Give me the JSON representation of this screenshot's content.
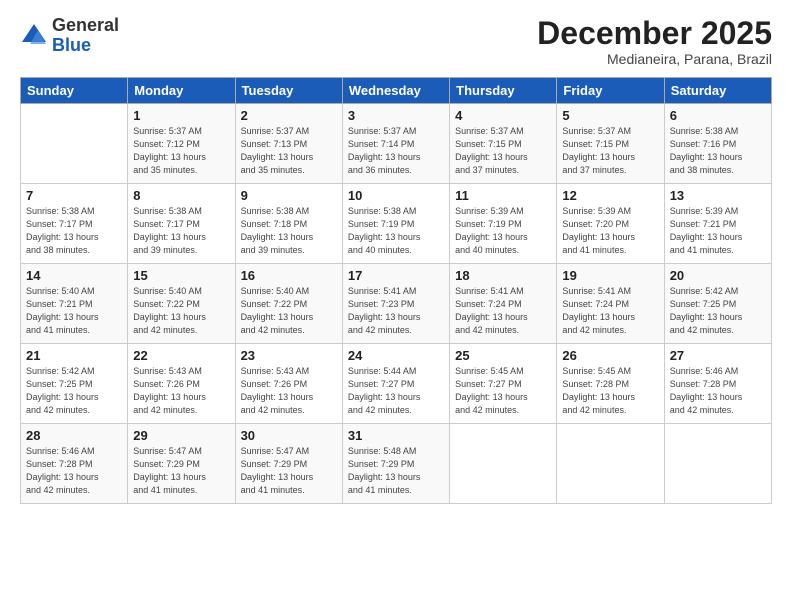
{
  "logo": {
    "general": "General",
    "blue": "Blue"
  },
  "title": "December 2025",
  "location": "Medianeira, Parana, Brazil",
  "days_of_week": [
    "Sunday",
    "Monday",
    "Tuesday",
    "Wednesday",
    "Thursday",
    "Friday",
    "Saturday"
  ],
  "weeks": [
    [
      {
        "day": "",
        "info": ""
      },
      {
        "day": "1",
        "info": "Sunrise: 5:37 AM\nSunset: 7:12 PM\nDaylight: 13 hours\nand 35 minutes."
      },
      {
        "day": "2",
        "info": "Sunrise: 5:37 AM\nSunset: 7:13 PM\nDaylight: 13 hours\nand 35 minutes."
      },
      {
        "day": "3",
        "info": "Sunrise: 5:37 AM\nSunset: 7:14 PM\nDaylight: 13 hours\nand 36 minutes."
      },
      {
        "day": "4",
        "info": "Sunrise: 5:37 AM\nSunset: 7:15 PM\nDaylight: 13 hours\nand 37 minutes."
      },
      {
        "day": "5",
        "info": "Sunrise: 5:37 AM\nSunset: 7:15 PM\nDaylight: 13 hours\nand 37 minutes."
      },
      {
        "day": "6",
        "info": "Sunrise: 5:38 AM\nSunset: 7:16 PM\nDaylight: 13 hours\nand 38 minutes."
      }
    ],
    [
      {
        "day": "7",
        "info": "Sunrise: 5:38 AM\nSunset: 7:17 PM\nDaylight: 13 hours\nand 38 minutes."
      },
      {
        "day": "8",
        "info": "Sunrise: 5:38 AM\nSunset: 7:17 PM\nDaylight: 13 hours\nand 39 minutes."
      },
      {
        "day": "9",
        "info": "Sunrise: 5:38 AM\nSunset: 7:18 PM\nDaylight: 13 hours\nand 39 minutes."
      },
      {
        "day": "10",
        "info": "Sunrise: 5:38 AM\nSunset: 7:19 PM\nDaylight: 13 hours\nand 40 minutes."
      },
      {
        "day": "11",
        "info": "Sunrise: 5:39 AM\nSunset: 7:19 PM\nDaylight: 13 hours\nand 40 minutes."
      },
      {
        "day": "12",
        "info": "Sunrise: 5:39 AM\nSunset: 7:20 PM\nDaylight: 13 hours\nand 41 minutes."
      },
      {
        "day": "13",
        "info": "Sunrise: 5:39 AM\nSunset: 7:21 PM\nDaylight: 13 hours\nand 41 minutes."
      }
    ],
    [
      {
        "day": "14",
        "info": "Sunrise: 5:40 AM\nSunset: 7:21 PM\nDaylight: 13 hours\nand 41 minutes."
      },
      {
        "day": "15",
        "info": "Sunrise: 5:40 AM\nSunset: 7:22 PM\nDaylight: 13 hours\nand 42 minutes."
      },
      {
        "day": "16",
        "info": "Sunrise: 5:40 AM\nSunset: 7:22 PM\nDaylight: 13 hours\nand 42 minutes."
      },
      {
        "day": "17",
        "info": "Sunrise: 5:41 AM\nSunset: 7:23 PM\nDaylight: 13 hours\nand 42 minutes."
      },
      {
        "day": "18",
        "info": "Sunrise: 5:41 AM\nSunset: 7:24 PM\nDaylight: 13 hours\nand 42 minutes."
      },
      {
        "day": "19",
        "info": "Sunrise: 5:41 AM\nSunset: 7:24 PM\nDaylight: 13 hours\nand 42 minutes."
      },
      {
        "day": "20",
        "info": "Sunrise: 5:42 AM\nSunset: 7:25 PM\nDaylight: 13 hours\nand 42 minutes."
      }
    ],
    [
      {
        "day": "21",
        "info": "Sunrise: 5:42 AM\nSunset: 7:25 PM\nDaylight: 13 hours\nand 42 minutes."
      },
      {
        "day": "22",
        "info": "Sunrise: 5:43 AM\nSunset: 7:26 PM\nDaylight: 13 hours\nand 42 minutes."
      },
      {
        "day": "23",
        "info": "Sunrise: 5:43 AM\nSunset: 7:26 PM\nDaylight: 13 hours\nand 42 minutes."
      },
      {
        "day": "24",
        "info": "Sunrise: 5:44 AM\nSunset: 7:27 PM\nDaylight: 13 hours\nand 42 minutes."
      },
      {
        "day": "25",
        "info": "Sunrise: 5:45 AM\nSunset: 7:27 PM\nDaylight: 13 hours\nand 42 minutes."
      },
      {
        "day": "26",
        "info": "Sunrise: 5:45 AM\nSunset: 7:28 PM\nDaylight: 13 hours\nand 42 minutes."
      },
      {
        "day": "27",
        "info": "Sunrise: 5:46 AM\nSunset: 7:28 PM\nDaylight: 13 hours\nand 42 minutes."
      }
    ],
    [
      {
        "day": "28",
        "info": "Sunrise: 5:46 AM\nSunset: 7:28 PM\nDaylight: 13 hours\nand 42 minutes."
      },
      {
        "day": "29",
        "info": "Sunrise: 5:47 AM\nSunset: 7:29 PM\nDaylight: 13 hours\nand 41 minutes."
      },
      {
        "day": "30",
        "info": "Sunrise: 5:47 AM\nSunset: 7:29 PM\nDaylight: 13 hours\nand 41 minutes."
      },
      {
        "day": "31",
        "info": "Sunrise: 5:48 AM\nSunset: 7:29 PM\nDaylight: 13 hours\nand 41 minutes."
      },
      {
        "day": "",
        "info": ""
      },
      {
        "day": "",
        "info": ""
      },
      {
        "day": "",
        "info": ""
      }
    ]
  ]
}
